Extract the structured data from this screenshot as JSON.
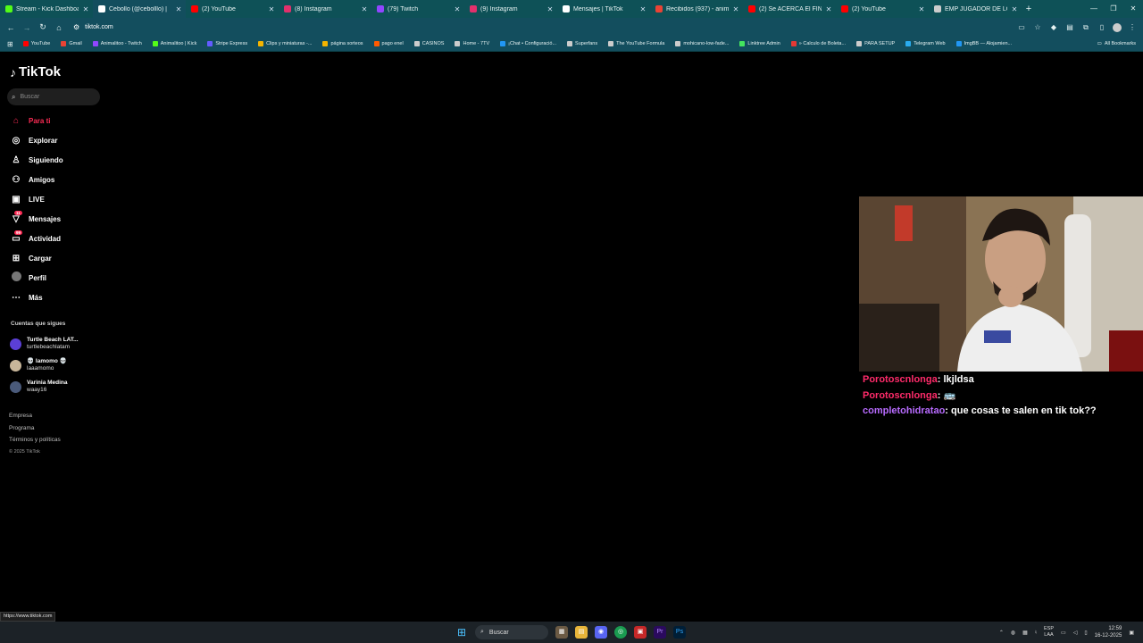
{
  "browser": {
    "tabs": [
      {
        "title": "Stream - Kick Dashboard",
        "favicon": "kick-icon",
        "color": "#53fc18"
      },
      {
        "title": "Cebollo (@cebolllo) |",
        "favicon": "tiktok-icon",
        "color": "#ffffff",
        "active": true
      },
      {
        "title": "(2) YouTube",
        "favicon": "youtube-icon",
        "color": "#ff0000"
      },
      {
        "title": "(8) Instagram",
        "favicon": "instagram-icon",
        "color": "#e1306c"
      },
      {
        "title": "(79) Twitch",
        "favicon": "twitch-icon",
        "color": "#9146ff"
      },
      {
        "title": "(9) Instagram",
        "favicon": "instagram-icon",
        "color": "#e1306c"
      },
      {
        "title": "Mensajes | TikTok",
        "favicon": "tiktok-icon",
        "color": "#ffffff"
      },
      {
        "title": "Recibidos (937) - animali",
        "favicon": "gmail-icon",
        "color": "#ea4335"
      },
      {
        "title": "(2) Se ACERCA El FINAL d",
        "favicon": "youtube-icon",
        "color": "#ff0000"
      },
      {
        "title": "(2) YouTube",
        "favicon": "youtube-icon",
        "color": "#ff0000"
      },
      {
        "title": "EMP JUGADOR DE LOL -",
        "favicon": "globe-icon",
        "color": "#cccccc"
      }
    ],
    "new_tab": "+",
    "url": "tiktok.com",
    "bookmarks": [
      {
        "label": "YouTube",
        "color": "#ff0000"
      },
      {
        "label": "Gmail",
        "color": "#ea4335"
      },
      {
        "label": "Animalitoo - Twitch",
        "color": "#9146ff"
      },
      {
        "label": "Animalitoo | Kick",
        "color": "#53fc18"
      },
      {
        "label": "Stripe Express",
        "color": "#635bff"
      },
      {
        "label": "Clips y miniaturas -...",
        "color": "#f4b400"
      },
      {
        "label": "página sorteos",
        "color": "#f4b400"
      },
      {
        "label": "pago enel",
        "color": "#ff5a00"
      },
      {
        "label": "CASINOS",
        "color": "#cccccc"
      },
      {
        "label": "Home - 7TV",
        "color": "#cccccc"
      },
      {
        "label": "¡Chat • Configuració...",
        "color": "#2196f3"
      },
      {
        "label": "Superfans",
        "color": "#cccccc"
      },
      {
        "label": "The YouTube Formula",
        "color": "#cccccc"
      },
      {
        "label": "mohicano-low-fade...",
        "color": "#cccccc"
      },
      {
        "label": "Linktree Admin",
        "color": "#43e55e"
      },
      {
        "label": "» Calculo de Boleta...",
        "color": "#e53935"
      },
      {
        "label": "PARA SETUP",
        "color": "#cccccc"
      },
      {
        "label": "Telegram Web",
        "color": "#2aabee"
      },
      {
        "label": "ImgBB — Alojamien...",
        "color": "#2196f3"
      }
    ],
    "all_bookmarks": "All Bookmarks"
  },
  "tiktok": {
    "logo": "TikTok",
    "search_placeholder": "Buscar",
    "menu": [
      {
        "label": "Para ti",
        "icon": "home-icon",
        "glyph": "⌂",
        "active": true
      },
      {
        "label": "Explorar",
        "icon": "compass-icon",
        "glyph": "◎"
      },
      {
        "label": "Siguiendo",
        "icon": "following-icon",
        "glyph": "♙"
      },
      {
        "label": "Amigos",
        "icon": "friends-icon",
        "glyph": "⚇"
      },
      {
        "label": "LIVE",
        "icon": "live-icon",
        "glyph": "▣"
      },
      {
        "label": "Mensajes",
        "icon": "messages-icon",
        "glyph": "▽",
        "badge": "11"
      },
      {
        "label": "Actividad",
        "icon": "activity-icon",
        "glyph": "▭",
        "badge": "99"
      },
      {
        "label": "Cargar",
        "icon": "upload-icon",
        "glyph": "⊞"
      },
      {
        "label": "Perfil",
        "icon": "profile-avatar",
        "glyph": ""
      },
      {
        "label": "Más",
        "icon": "more-icon",
        "glyph": "⋯"
      }
    ],
    "following_title": "Cuentas que sigues",
    "accounts": [
      {
        "name": "Turtle Beach LAT...",
        "user": "turtlebeachlatam",
        "color": "#5b3fd6"
      },
      {
        "name": "💀 lamomo 💀",
        "user": "laaamomo",
        "color": "#c8b69a"
      },
      {
        "name": "Varinia Medina",
        "user": "waay16",
        "color": "#4a5a7a"
      }
    ],
    "footer": {
      "company": "Empresa",
      "program": "Programa",
      "terms": "Términos y políticas",
      "copyright": "© 2025 TikTok"
    }
  },
  "chat": [
    {
      "user": "Porotoscnlonga",
      "user_color": "#ff2b6a",
      "message": "lkjldsa"
    },
    {
      "user": "Porotoscnlonga",
      "user_color": "#ff2b6a",
      "message": "🚌"
    },
    {
      "user": "completohidratao",
      "user_color": "#b86bff",
      "message": "que cosas te salen en tik tok??"
    }
  ],
  "status_url": "https://www.tiktok.com",
  "taskbar": {
    "search_label": "Buscar",
    "lang": "ESP",
    "lang_sub": "LAA",
    "time": "12:59",
    "date": "16-12-2025"
  }
}
